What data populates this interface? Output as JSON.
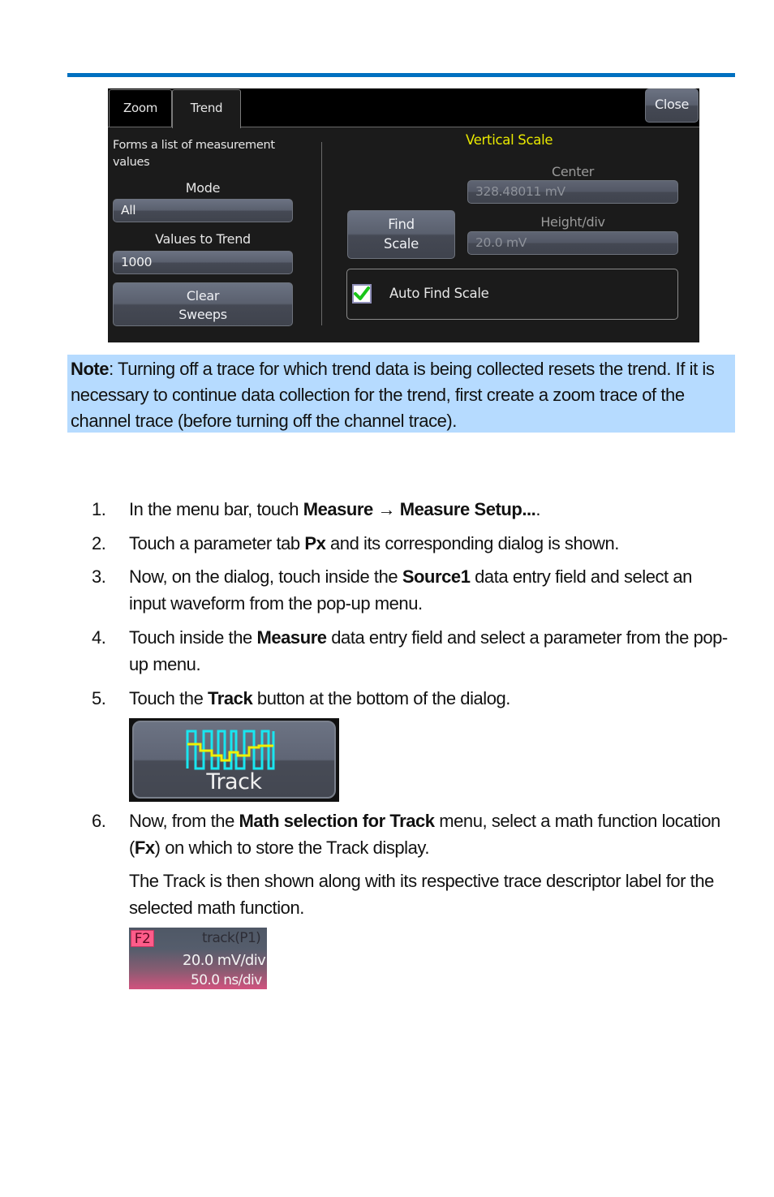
{
  "colors": {
    "rule": "#0070c0",
    "note_background": "#b6dbff",
    "vertical_scale_title": "#e8e800",
    "checkmark": "#19c519",
    "track_icon_square": "#19e6f0",
    "track_icon_trend": "#f0f000",
    "descriptor_badge": "#ff5c8a"
  },
  "dialog": {
    "tabs": [
      {
        "label": "Zoom",
        "active": false
      },
      {
        "label": "Trend",
        "active": true
      }
    ],
    "close_label": "Close",
    "description": "Forms a list of measurement values",
    "mode": {
      "label": "Mode",
      "value": "All"
    },
    "values_to_trend": {
      "label": "Values to Trend",
      "value": "1000"
    },
    "clear_sweeps": {
      "line1": "Clear",
      "line2": "Sweeps"
    },
    "vertical_scale": {
      "title": "Vertical Scale",
      "center": {
        "label": "Center",
        "value": "328.48011 mV"
      },
      "height_div": {
        "label": "Height/div",
        "value": "20.0 mV"
      }
    },
    "find_scale": {
      "line1": "Find",
      "line2": "Scale"
    },
    "auto_find_scale": {
      "label": "Auto Find Scale",
      "checked": true
    }
  },
  "note": {
    "label": "Note",
    "text": ": Turning off a trace for which trend data is being collected resets the trend. If it is necessary to continue data collection for the trend, first create a zoom trace of the channel trace (before turning off the channel trace)."
  },
  "steps": [
    {
      "num": "1.",
      "parts": [
        "In the menu bar, touch ",
        "Measure → Measure Setup...",
        "."
      ]
    },
    {
      "num": "2.",
      "parts": [
        "Touch a parameter tab ",
        "Px",
        " and its corresponding dialog is shown."
      ]
    },
    {
      "num": "3.",
      "parts": [
        "Now, on the dialog, touch inside the ",
        "Source1",
        " data entry field and select an input waveform from the pop-up menu."
      ]
    },
    {
      "num": "4.",
      "parts": [
        "Touch inside the ",
        "Measure",
        " data entry field and select a parameter from the pop-up menu."
      ]
    },
    {
      "num": "5.",
      "parts": [
        "Touch the ",
        "Track",
        " button at the bottom of the dialog."
      ]
    },
    {
      "num": "6.",
      "parts": [
        "Now, from the ",
        "Math selection for Track",
        " menu, select a math function location (",
        "Fx",
        ") on which to store the Track display."
      ]
    }
  ],
  "step6_followup": "The Track is then shown along with its respective trace descriptor label for the selected math function.",
  "track_button": {
    "label": "Track",
    "icon": "track-waveform-icon"
  },
  "trace_descriptor": {
    "badge": "F2",
    "function": "track(P1)",
    "vertical": "20.0 mV/div",
    "horizontal": "50.0 ns/div"
  }
}
